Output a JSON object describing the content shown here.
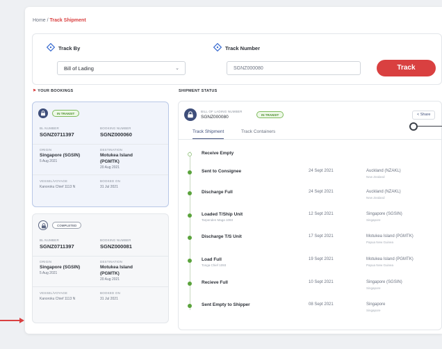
{
  "breadcrumb": {
    "home": "Home",
    "separator": " / ",
    "current": "Track Shipment"
  },
  "search": {
    "track_by_label": "Track By",
    "track_by_value": "Bill of Lading",
    "track_number_label": "Track Number",
    "track_number_value": "SGNZ000080",
    "track_button": "Track"
  },
  "bookings": {
    "heading": "YOUR BOOKINGS",
    "items": [
      {
        "status": "IN TRANSIT",
        "bl_label": "BL NUMBER",
        "bl_value": "SGNZ0711397",
        "booking_label": "BOOKING NUMBER",
        "booking_value": "SGNZ000060",
        "origin_label": "ORIGIN",
        "origin_value": "Singapore (SGSIN)",
        "origin_date": "5 Aug 2021",
        "dest_label": "DESTINATION",
        "dest_value_1": "Motukea Island",
        "dest_value_2": "(PGMTK)",
        "dest_date": "20 Aug 2021",
        "vessel_label": "VESSEL/VOYAGE",
        "vessel_value": "Kanoroku Chief 1113 N",
        "booked_label": "BOOKED ON",
        "booked_value": "31 Jul 2021"
      },
      {
        "status": "COMPLETED",
        "bl_label": "BL NUMBER",
        "bl_value": "SGNZ0711397",
        "booking_label": "BOOKING NUMBER",
        "booking_value": "SGNZ000081",
        "origin_label": "ORIGIN",
        "origin_value": "Singapore (SGSIN)",
        "origin_date": "5 Aug 2021",
        "dest_label": "DESTINATION",
        "dest_value_1": "Motukea Island",
        "dest_value_2": "(PGMTK)",
        "dest_date": "20 Aug 2021",
        "vessel_label": "VESSEL/VOYAGE",
        "vessel_value": "Kanoroku Chief 1113 N",
        "booked_label": "BOOKED ON",
        "booked_value": "31 Jul 2021"
      }
    ]
  },
  "shipment": {
    "heading": "SHIPMENT STATUS",
    "bol_label": "BILL OF LADING NUMBER",
    "bol_value": "SGNZ000080",
    "status": "IN TRANSIT",
    "share": "Share",
    "tabs": [
      {
        "label": "Track Shipment"
      },
      {
        "label": "Track Containers"
      }
    ],
    "events": [
      {
        "name": "Receive Empty",
        "sub": "",
        "date": "",
        "loc": "",
        "loc_sub": ""
      },
      {
        "name": "Sent to Consignee",
        "sub": "",
        "date": "24 Sept 2021",
        "loc": "Auckland (NZAKL)",
        "loc_sub": "New Zealand"
      },
      {
        "name": "Discharge Full",
        "sub": "",
        "date": "24 Sept 2021",
        "loc": "Auckland (NZAKL)",
        "loc_sub": "New Zealand"
      },
      {
        "name": "Loaded T/Ship Unit",
        "sub": "Tarpenden Maga 1093",
        "date": "12 Sept 2021",
        "loc": "Singapore (SGSIN)",
        "loc_sub": "Singapore"
      },
      {
        "name": "Discharge T/S Unit",
        "sub": "",
        "date": "17 Sept 2021",
        "loc": "Motukea Island (PGMTK)",
        "loc_sub": "Papua New Guinea"
      },
      {
        "name": "Load Full",
        "sub": "Tonga Chief 1093",
        "date": "19 Sept 2021",
        "loc": "Motukea Island (PGMTK)",
        "loc_sub": "Papua New Guinea"
      },
      {
        "name": "Recieve Full",
        "sub": "",
        "date": "10 Sept 2021",
        "loc": "Singapore (SGSIN)",
        "loc_sub": "Singapore"
      },
      {
        "name": "Sent Empty to Shipper",
        "sub": "",
        "date": "08 Sept 2021",
        "loc": "Singapore",
        "loc_sub": "Singapore"
      }
    ]
  },
  "colors": {
    "accent_red": "#d94040",
    "navy": "#3e4e7a",
    "transit_green": "#5aa33c"
  },
  "icons": {
    "track_by": "diamond-target-icon",
    "track_number": "diamond-target-icon",
    "booking": "lock-icon",
    "share": "share-icon",
    "flag": "flag-icon"
  }
}
